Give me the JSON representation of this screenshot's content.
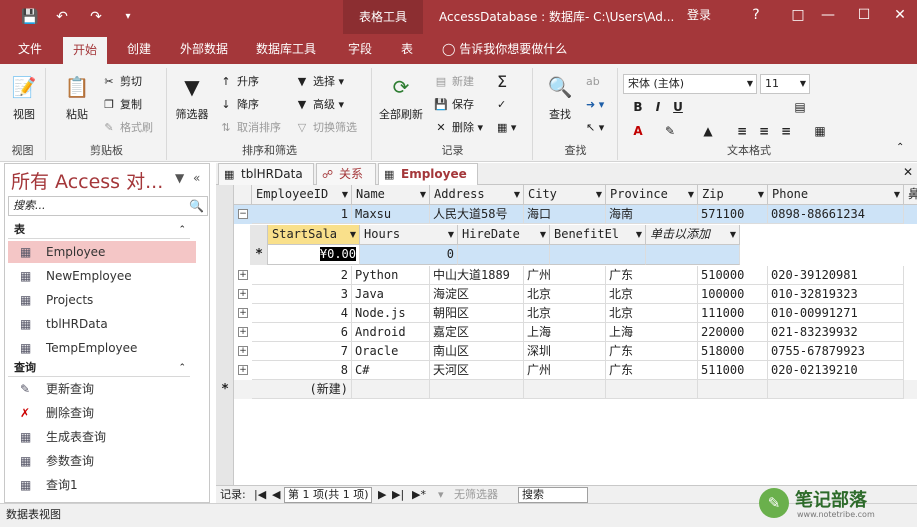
{
  "window": {
    "context_tab": "表格工具",
    "title": "AccessDatabase : 数据库- C:\\Users\\Ad...",
    "login": "登录",
    "help": "?"
  },
  "qat": {
    "save_icon": "save-icon",
    "undo_icon": "undo-icon",
    "redo_icon": "redo-icon"
  },
  "tabs": [
    "文件",
    "开始",
    "创建",
    "外部数据",
    "数据库工具",
    "字段",
    "表"
  ],
  "tell_me": "告诉我你想要做什么",
  "ribbon": {
    "views": {
      "view": "视图",
      "group": "视图"
    },
    "clipboard": {
      "paste": "粘贴",
      "cut": "剪切",
      "copy": "复制",
      "format_painter": "格式刷",
      "group": "剪贴板"
    },
    "sort_filter": {
      "filter": "筛选器",
      "asc": "升序",
      "desc": "降序",
      "clear_sort": "取消排序",
      "select": "选择",
      "advanced": "高级",
      "toggle_filter": "切换筛选",
      "group": "排序和筛选"
    },
    "records": {
      "refresh_all": "全部刷新",
      "new": "新建",
      "save": "保存",
      "delete": "删除",
      "group": "记录"
    },
    "find": {
      "find": "查找",
      "group": "查找"
    },
    "text_format": {
      "font": "宋体 (主体)",
      "size": "11",
      "bold": "B",
      "italic": "I",
      "underline": "U",
      "group": "文本格式"
    }
  },
  "nav": {
    "title": "所有 Access 对...",
    "search_placeholder": "搜索...",
    "tables_label": "表",
    "tables": [
      "Employee",
      "NewEmployee",
      "Projects",
      "tblHRData",
      "TempEmployee"
    ],
    "queries_label": "查询",
    "queries": [
      "更新查询",
      "删除查询",
      "生成表查询",
      "参数查询",
      "查询1"
    ]
  },
  "doc_tabs": [
    "tblHRData",
    "关系",
    "Employee"
  ],
  "sheet": {
    "columns": [
      "EmployeeID",
      "Name",
      "Address",
      "City",
      "Province",
      "Zip",
      "Phone",
      "鼻"
    ],
    "rows": [
      [
        "1",
        "Maxsu",
        "人民大道58号",
        "海口",
        "海南",
        "571100",
        "0898-88661234"
      ],
      [
        "2",
        "Python",
        "中山大道1889",
        "广州",
        "广东",
        "510000",
        "020-39120981"
      ],
      [
        "3",
        "Java",
        "海淀区",
        "北京",
        "北京",
        "100000",
        "010-32819323"
      ],
      [
        "4",
        "Node.js",
        "朝阳区",
        "北京",
        "北京",
        "111000",
        "010-00991271"
      ],
      [
        "6",
        "Android",
        "嘉定区",
        "上海",
        "上海",
        "220000",
        "021-83239932"
      ],
      [
        "7",
        "Oracle",
        "南山区",
        "深圳",
        "广东",
        "518000",
        "0755-67879923"
      ],
      [
        "8",
        "C#",
        "天河区",
        "广州",
        "广东",
        "511000",
        "020-02139210"
      ]
    ],
    "new_row": "(新建)",
    "sub_columns": [
      "StartSala",
      "Hours",
      "HireDate",
      "BenefitEl",
      "单击以添加"
    ],
    "sub_values": [
      "¥0.00",
      "0"
    ]
  },
  "recnav": {
    "label": "记录:",
    "position": "第 1 项(共 1 项)",
    "no_filter": "无筛选器",
    "search": "搜索"
  },
  "status": "数据表视图",
  "watermark": {
    "text": "笔记部落",
    "url": "www.notetribe.com"
  },
  "colors": {
    "accent": "#a4373a",
    "selected_row": "#cde3f7",
    "nav_selected": "#f4c6c6"
  }
}
